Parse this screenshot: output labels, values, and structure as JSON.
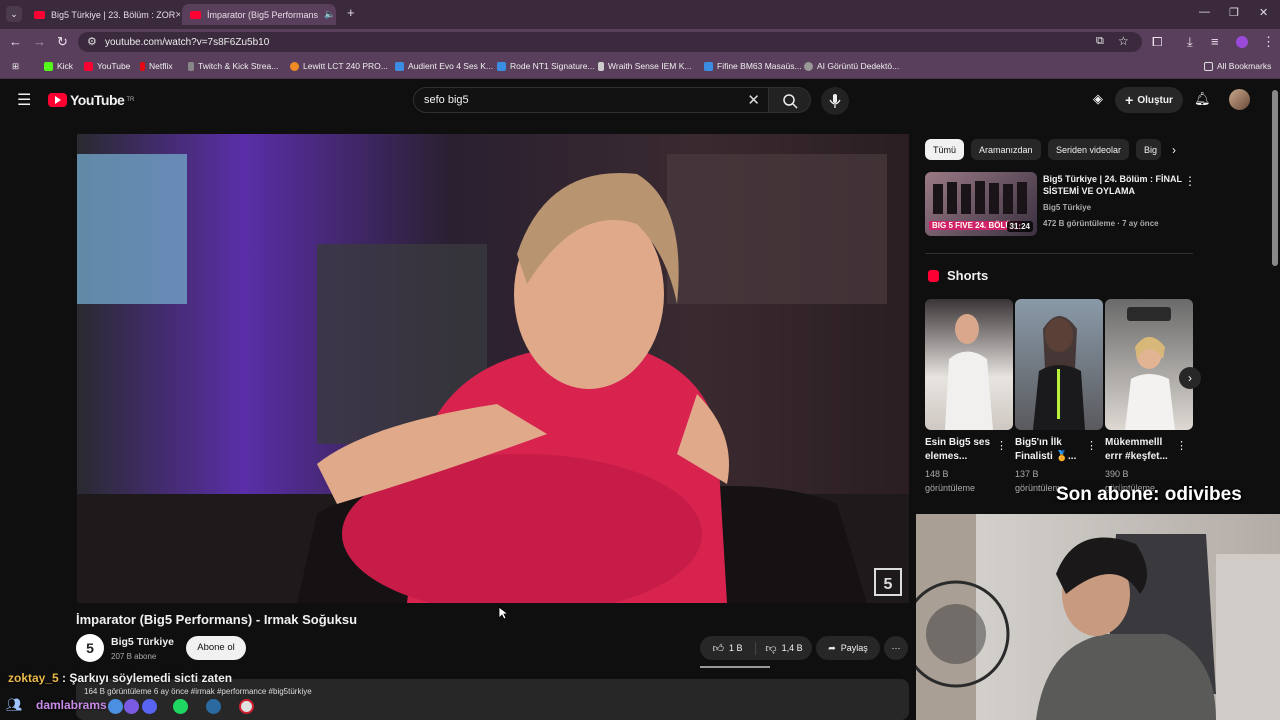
{
  "browser": {
    "tabs": [
      {
        "title": "Big5 Türkiye | 23. Bölüm : ZOR"
      },
      {
        "title": "İmparator (Big5 Performans"
      }
    ],
    "url": "youtube.com/watch?v=7s8F6Zu5b10",
    "bookmarks": [
      "Kick",
      "YouTube",
      "Netflix",
      "Twitch & Kick Strea...",
      "Lewitt LCT 240 PRO...",
      "Audient Evo 4 Ses K...",
      "Rode NT1 Signature...",
      "Wraith Sense IEM K...",
      "Fifine BM63 Masaüs...",
      "AI Görüntü Dedektö..."
    ],
    "all_bookmarks": "All Bookmarks"
  },
  "youtube": {
    "logo_text": "YouTube",
    "logo_region": "TR",
    "search_value": "sefo big5",
    "create_label": "Oluştur"
  },
  "video": {
    "title": "İmparator (Big5 Performans) - Irmak Soğuksu",
    "channel": "Big5 Türkiye",
    "subscribers": "207 B abone",
    "subscribe_label": "Abone ol",
    "likes": "1 B",
    "dislikes": "1,4 B",
    "share_label": "Paylaş",
    "description": "164 B görüntüleme  6 ay önce  #irmak #performance #big5türkiye",
    "corner_logo": "5"
  },
  "sidebar": {
    "chips": [
      "Tümü",
      "Aramanızdan",
      "Seriden videolar",
      "Big"
    ],
    "recommended": {
      "title": "Big5 Türkiye | 24. Bölüm : FİNAL SİSTEMİ VE OYLAMA",
      "channel": "Big5 Türkiye",
      "meta": "472 B görüntüleme · 7 ay önce",
      "duration": "31:24",
      "badge": "BIG 5 FIVE 24. BÖLÜM"
    },
    "shorts_heading": "Shorts",
    "shorts": [
      {
        "title": "Esin Big5 ses elemes...",
        "views": "148 B",
        "views_label": "görüntüleme"
      },
      {
        "title": "Big5'ın İlk Finalisti 🏅...",
        "views": "137 B",
        "views_label": "görüntüleme"
      },
      {
        "title": "Mükemmelll errr #keşfet...",
        "views": "390 B",
        "views_label": "görüntüleme"
      }
    ]
  },
  "overlay": {
    "last_subscriber": "Son abone: odivibes",
    "chat_user": "zoktay_5",
    "chat_message": " : Şarkıyı söylemedi sicti zaten",
    "tray_user": "damlabrams"
  }
}
